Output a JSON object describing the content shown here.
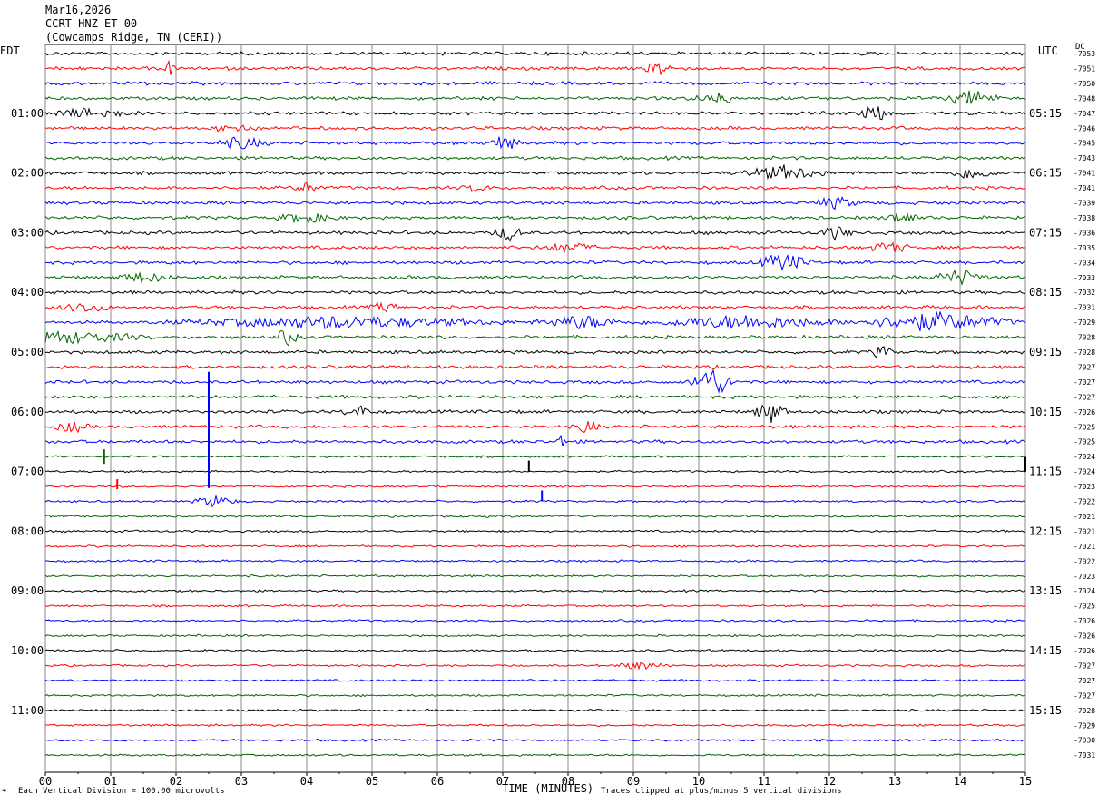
{
  "header": {
    "date": "Mar16,2026",
    "channel": "CCRT HNZ ET 00",
    "station": "(Cowcamps Ridge, TN (CERI))"
  },
  "left_tz": "EDT",
  "right_tz": "UTC",
  "right_unit": "DC",
  "footer": {
    "scale_note": "Each Vertical Division = 100.00 microvolts",
    "x_title": "TIME (MINUTES)",
    "clip_note": "Traces clipped at plus/minus 5 vertical divisions"
  },
  "chart_data": {
    "type": "line",
    "title": "CCRT HNZ ET 00",
    "xlabel": "TIME (MINUTES)",
    "xlim": [
      0,
      15
    ],
    "x_ticks": [
      "00",
      "01",
      "02",
      "03",
      "04",
      "05",
      "06",
      "07",
      "08",
      "09",
      "10",
      "11",
      "12",
      "13",
      "14",
      "15"
    ],
    "trace_colors": [
      "#000000",
      "#ff0000",
      "#0000ff",
      "#006400"
    ],
    "left_time_labels": [
      "01:00",
      "02:00",
      "03:00",
      "04:00",
      "05:00",
      "06:00",
      "07:00",
      "08:00",
      "09:00",
      "10:00",
      "11:00"
    ],
    "right_time_labels": [
      "05:15",
      "06:15",
      "07:15",
      "08:15",
      "09:15",
      "10:15",
      "11:15",
      "12:15",
      "13:15",
      "14:15",
      "15:15"
    ],
    "dc_offsets": [
      "-7053",
      "-7051",
      "-7050",
      "-7048",
      "-7047",
      "-7046",
      "-7045",
      "-7043",
      "-7041",
      "-7041",
      "-7039",
      "-7038",
      "-7036",
      "-7035",
      "-7034",
      "-7033",
      "-7032",
      "-7031",
      "-7029",
      "-7028",
      "-7028",
      "-7027",
      "-7027",
      "-7027",
      "-7026",
      "-7025",
      "-7025",
      "-7024",
      "-7024",
      "-7023",
      "-7022",
      "-7021",
      "-7021",
      "-7021",
      "-7022",
      "-7023",
      "-7024",
      "-7025",
      "-7026",
      "-7026",
      "-7026",
      "-7027",
      "-7027",
      "-7027",
      "-7028",
      "-7029",
      "-7030",
      "-7031"
    ],
    "trace_count": 48,
    "grid": true
  }
}
